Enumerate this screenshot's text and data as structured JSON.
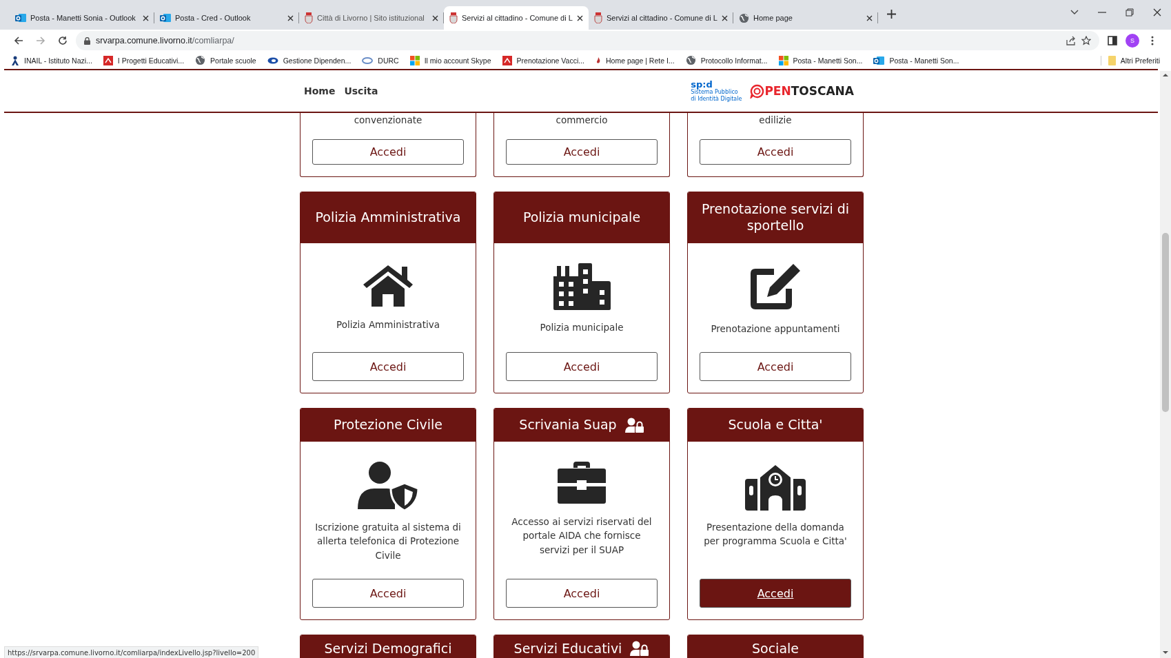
{
  "browser": {
    "tabs": [
      {
        "title": "Posta - Manetti Sonia - Outlook",
        "selected": false
      },
      {
        "title": "Posta - Cred - Outlook",
        "selected": false
      },
      {
        "title": "Città di Livorno | Sito istituzional",
        "selected": false
      },
      {
        "title": "Servizi al cittadino - Comune di L",
        "selected": true
      },
      {
        "title": "Servizi al cittadino - Comune di L",
        "selected": false
      },
      {
        "title": "Home page",
        "selected": false
      }
    ],
    "address": {
      "host": "srvarpa.comune.livorno.it",
      "path": "/comliarpa/"
    },
    "profile": "S",
    "bookmarks": [
      {
        "label": "INAIL - Istituto Nazi..."
      },
      {
        "label": "I Progetti Educativi..."
      },
      {
        "label": "Portale scuole"
      },
      {
        "label": "Gestione Dipenden..."
      },
      {
        "label": "DURC"
      },
      {
        "label": "Il mio account Skype"
      },
      {
        "label": "Prenotazione Vacci..."
      },
      {
        "label": "Home page | Rete I..."
      },
      {
        "label": "Protocollo Informat..."
      },
      {
        "label": "Posta - Manetti Son..."
      },
      {
        "label": "Posta - Manetti Son..."
      }
    ],
    "other_bookmarks": "Altri Preferiti"
  },
  "site_header": {
    "nav": [
      "Home",
      "Uscita"
    ],
    "spid_logo": {
      "mark": "sp:d",
      "caption": [
        "Sistema Pubblico",
        "di Identità Digitale"
      ]
    },
    "brand": {
      "first": "PEN",
      "second": "TOSCANA"
    }
  },
  "card_rows": [
    [
      {
        "kind": "partial",
        "description": "convenzionate",
        "button": "Accedi",
        "highlighted": false
      },
      {
        "kind": "partial",
        "description": "commercio",
        "button": "Accedi",
        "highlighted": false
      },
      {
        "kind": "partial",
        "description": "edilizie",
        "button": "Accedi",
        "highlighted": false
      }
    ],
    [
      {
        "kind": "full",
        "title": "Polizia Amministrativa",
        "restricted": false,
        "description": "Polizia Amministrativa",
        "button": "Accedi",
        "highlighted": false
      },
      {
        "kind": "full",
        "title": "Polizia municipale",
        "restricted": false,
        "description": "Polizia municipale",
        "button": "Accedi",
        "highlighted": false
      },
      {
        "kind": "full",
        "title": "Prenotazione servizi di sportello",
        "restricted": false,
        "description": "Prenotazione appuntamenti",
        "button": "Accedi",
        "highlighted": false
      }
    ],
    [
      {
        "kind": "full",
        "title": "Protezione Civile",
        "restricted": false,
        "description": "Iscrizione gratuita al sistema di allerta telefonica di Protezione Civile",
        "button": "Accedi",
        "highlighted": false
      },
      {
        "kind": "full",
        "title": "Scrivania Suap",
        "restricted": true,
        "description": "Accesso ai servizi riservati del portale AIDA che fornisce servizi per il SUAP",
        "button": "Accedi",
        "highlighted": false
      },
      {
        "kind": "full",
        "title": "Scuola e Citta'",
        "restricted": false,
        "description": "Presentazione della domanda per programma Scuola e Citta'",
        "button": "Accedi",
        "highlighted": true
      }
    ],
    [
      {
        "kind": "head",
        "title": "Servizi Demografici",
        "restricted": false
      },
      {
        "kind": "head",
        "title": "Servizi Educativi",
        "restricted": true
      },
      {
        "kind": "head",
        "title": "Sociale",
        "restricted": false
      }
    ]
  ],
  "status_url": "https://srvarpa.comune.livorno.it/comliarpa/indexLivello.jsp?livello=200"
}
